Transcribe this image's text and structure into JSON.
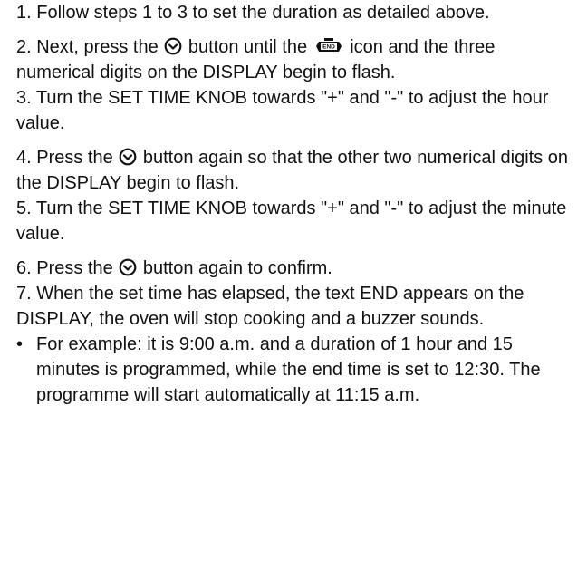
{
  "steps": {
    "s1": "1. Follow steps 1 to 3 to set the duration as detailed above.",
    "s2a": "2. Next, press the",
    "s2b": "button until the",
    "s2c": "icon and the three numerical digits on the DISPLAY begin to flash.",
    "s3": "3. Turn the SET TIME KNOB towards  \"+\" and \"-\"  to adjust the hour value.",
    "s4a": "4. Press the",
    "s4b": "button again so that the other two numerical digits on the DISPLAY begin to flash.",
    "s5": "5. Turn the SET TIME KNOB towards  \"+\" and \"-\"  to adjust the minute value.",
    "s6a": "6. Press the",
    "s6b": "button again to confirm.",
    "s7": "7. When the set time has elapsed, the text END appears on the DISPLAY, the oven will stop cooking and a buzzer sounds."
  },
  "bullet": {
    "symbol": "•",
    "text": "For example: it is 9:00 a.m. and a duration of 1 hour and 15 minutes is programmed, while the end time is set to 12:30. The programme will start automatically at 11:15 a.m."
  },
  "icons": {
    "clock": "clock-icon",
    "end_label": "END"
  }
}
